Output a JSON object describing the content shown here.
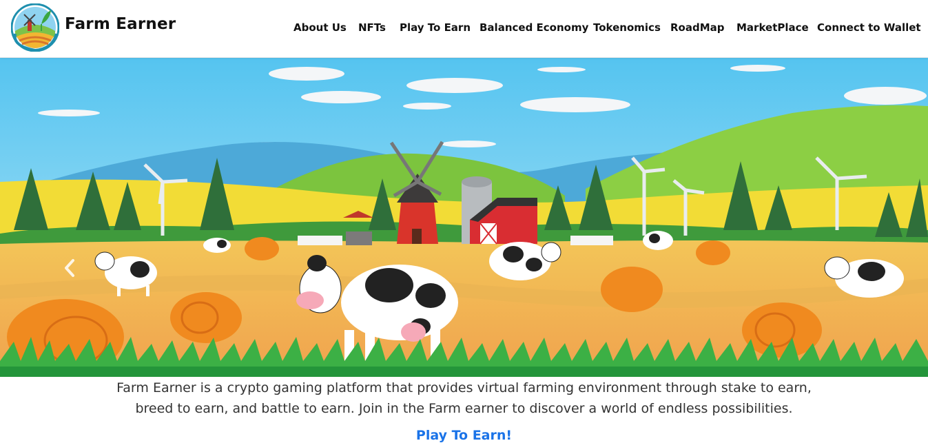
{
  "header": {
    "brand": "Farm Earner",
    "logo_icon": "farm-windmill-logo-icon",
    "nav": [
      {
        "label": "About Us"
      },
      {
        "label": "NFTs"
      },
      {
        "label": "Play To Earn"
      },
      {
        "label": "Balanced Economy"
      },
      {
        "label": "Tokenomics"
      },
      {
        "label": "RoadMap"
      },
      {
        "label": "MarketPlace"
      },
      {
        "label": "Connect to Wallet"
      }
    ]
  },
  "hero": {
    "image": "farm-illustration-with-cows-windmill-barn",
    "prev_icon": "chevron-left-icon"
  },
  "main": {
    "description_line1": "Farm Earner is a crypto gaming platform that provides virtual farming environment through stake to earn,",
    "description_line2": "breed to earn, and battle to earn. Join in the Farm earner to discover a world of endless possibilities.",
    "cta": "Play To Earn!"
  },
  "colors": {
    "link": "#1a73e8",
    "text": "#333333",
    "sky": "#7fd0f2",
    "grass": "#3cb045"
  }
}
